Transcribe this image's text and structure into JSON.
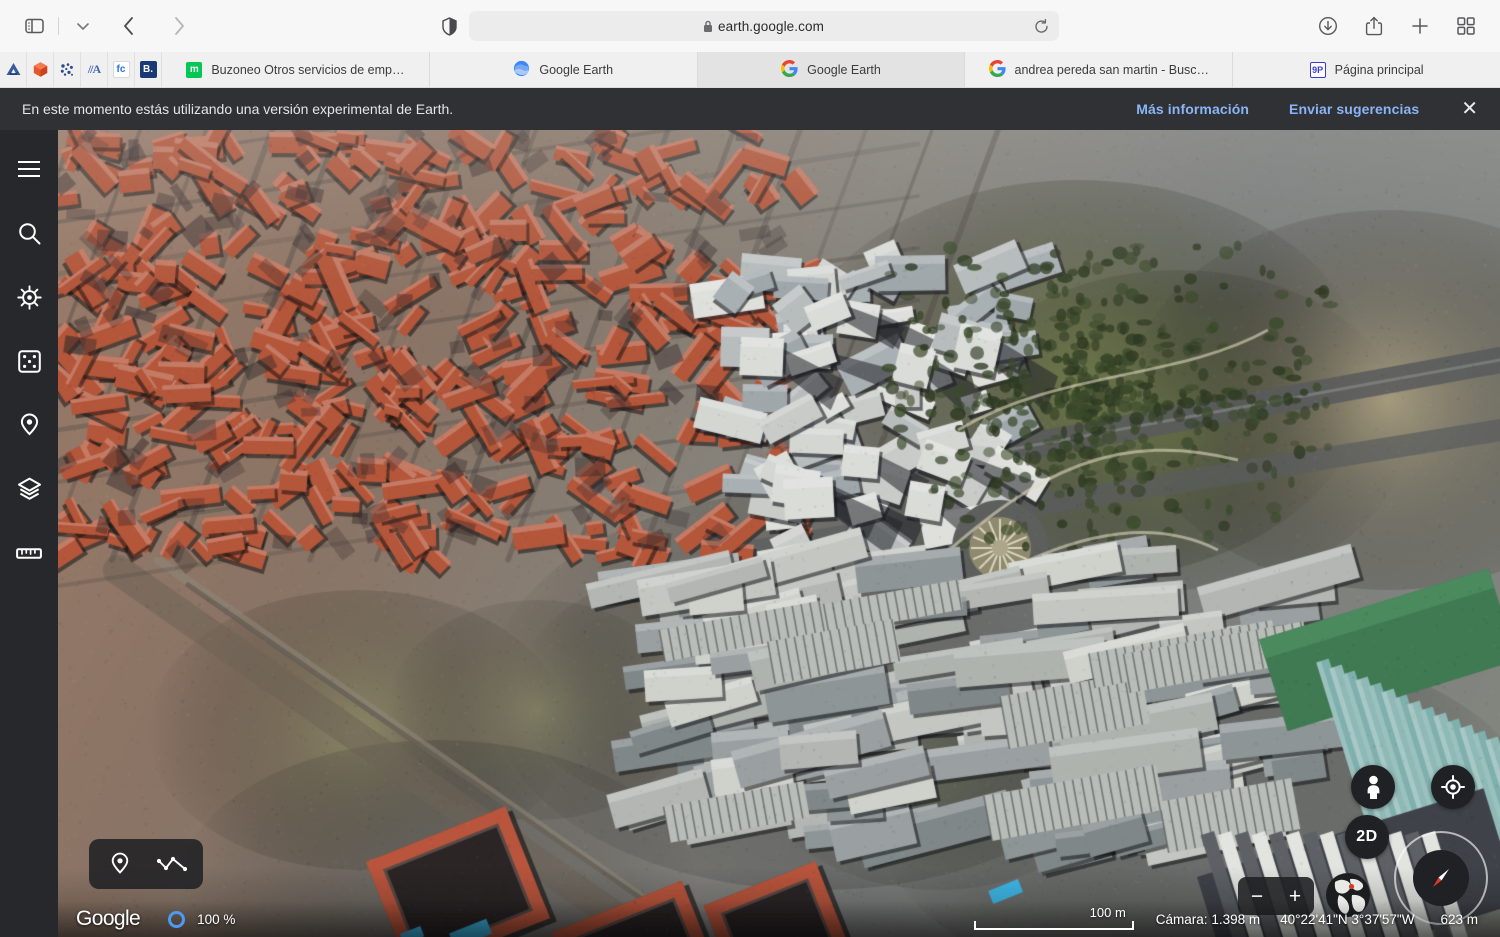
{
  "browser": {
    "nav": {
      "sidebar_toggle": "sidebar-toggle",
      "sidebar_dropdown": "chevron-down",
      "back": "back",
      "forward": "forward"
    },
    "address": {
      "url": "earth.google.com",
      "lock": "secure-lock",
      "reload": "reload"
    },
    "actions": [
      "downloads",
      "share",
      "new-tab",
      "tab-overview"
    ],
    "favicons": [
      {
        "name": "bookmark-fav-1",
        "glyph": "▲",
        "color": "#3a5a99",
        "bg": "#f0f0f0"
      },
      {
        "name": "bookmark-fav-2",
        "glyph": "⬢",
        "color": "#e8552d",
        "bg": "#f0f0f0"
      },
      {
        "name": "bookmark-fav-3",
        "glyph": "∷",
        "color": "#2b4a8b",
        "bg": "#f0f0f0"
      },
      {
        "name": "bookmark-fav-4",
        "glyph": "//A",
        "color": "#4a63b5",
        "bg": "#f0f0f0"
      },
      {
        "name": "bookmark-fav-5",
        "glyph": "fc",
        "color": "#2d6fe0",
        "bg": "#ffffff"
      },
      {
        "name": "bookmark-fav-6",
        "glyph": "B.",
        "color": "#ffffff",
        "bg": "#1b3a73"
      }
    ],
    "tabs": [
      {
        "title": "Buzoneo Otros servicios de emp…",
        "favicon": "m",
        "fav_bg": "#00c853",
        "fav_fg": "#ffffff",
        "active": false
      },
      {
        "title": "Google Earth",
        "favicon": "earth",
        "fav_bg": "#4285f4",
        "fav_fg": "#ffffff",
        "active": false
      },
      {
        "title": "Google Earth",
        "favicon": "google-g",
        "fav_bg": "#ffffff",
        "fav_fg": "#4285f4",
        "active": true
      },
      {
        "title": "andrea pereda san martin - Busc…",
        "favicon": "google-g",
        "fav_bg": "#ffffff",
        "fav_fg": "#4285f4",
        "active": false
      },
      {
        "title": "Página principal",
        "favicon": "9P",
        "fav_bg": "#ffffff",
        "fav_fg": "#3a3ad0",
        "active": false
      }
    ]
  },
  "earth": {
    "notice": {
      "message": "En este momento estás utilizando una versión experimental de Earth.",
      "more_info": "Más información",
      "feedback": "Enviar sugerencias",
      "close": "✕"
    },
    "rail": [
      {
        "name": "menu-icon",
        "label": "Menú"
      },
      {
        "name": "search-icon",
        "label": "Buscar"
      },
      {
        "name": "voyager-icon",
        "label": "Voyager"
      },
      {
        "name": "dice-icon",
        "label": "Me siento con suerte"
      },
      {
        "name": "placemark-icon",
        "label": "Proyectos"
      },
      {
        "name": "layers-icon",
        "label": "Capas"
      },
      {
        "name": "ruler-icon",
        "label": "Medir"
      }
    ],
    "tools": {
      "placemark": "placemark-tool",
      "path": "path-tool",
      "pegman": "pegman",
      "locate": "my-location",
      "view_2d": "2D",
      "globe": "globe-view",
      "compass": "compass-north",
      "zoom_out": "−",
      "zoom_in": "+"
    },
    "status": {
      "wordmark": "Google",
      "loading_percent": "100 %",
      "scale_label": "100 m",
      "camera": "Cámara: 1.398 m",
      "coordinates": "40°22'41\"N 3°37'57\"W",
      "elevation": "623 m"
    },
    "colors": {
      "panel": "#202124",
      "notice_bg": "#303134",
      "link": "#8ab4f8",
      "rail_bg": "#27282b",
      "accent_blue": "#4e9af1"
    }
  }
}
